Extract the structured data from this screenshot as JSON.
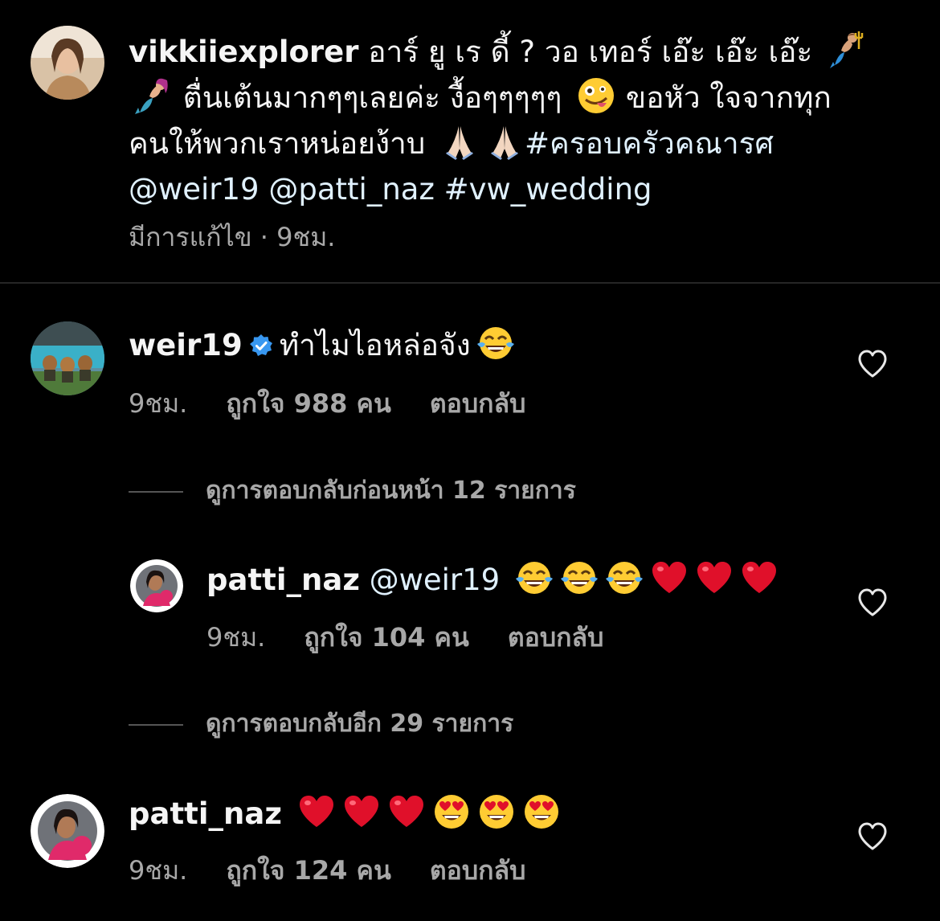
{
  "caption": {
    "username": "vikkiiexplorer",
    "text_line1": " อาร์ ยู เร ดี้ ? วอ เทอร์ เอ๊ะ เอ๊ะ เอ๊ะ ",
    "text_line2": " ตื่นเต้นมากๆๆเลยค่ะ งื้อๆๆๆๆๆ ",
    "text_line2b": "  ขอหัว ใจจากทุก",
    "text_line3": "คนให้พวกเราหน่อยง้าบ ",
    "hashtag1": "#ครอบครัวคณารศ",
    "mention1": "@weir19",
    "mention2": "@patti_naz",
    "hashtag2": "#vw_wedding",
    "meta_edited": "มีการแก้ไข · 9ชม."
  },
  "comments": [
    {
      "username": "weir19",
      "verified": true,
      "text": "ทำไมไอหล่อจัง",
      "time": "9ชม.",
      "likes": "ถูกใจ 988 คน",
      "reply": "ตอบกลับ"
    },
    {
      "username": "patti_naz",
      "mention": "@weir19",
      "time": "9ชม.",
      "likes": "ถูกใจ 104 คน",
      "reply": "ตอบกลับ"
    },
    {
      "username": "patti_naz",
      "time": "9ชม.",
      "likes": "ถูกใจ 124 คน",
      "reply": "ตอบกลับ"
    }
  ],
  "view_previous_replies": "ดูการตอบกลับก่อนหน้า 12 รายการ",
  "view_more_replies": "ดูการตอบกลับอีก 29 รายการ",
  "icons": {
    "like": "heart-outline-icon",
    "verified": "verified-badge-icon",
    "emoji_laugh": "face-with-tears-of-joy",
    "emoji_heart": "red-heart",
    "emoji_heart_eyes": "smiling-face-with-heart-eyes",
    "emoji_merman": "merman",
    "emoji_mermaid": "mermaid",
    "emoji_zany": "zany-face",
    "emoji_pray": "folded-hands"
  },
  "colors": {
    "background": "#000000",
    "text": "#f5f5f5",
    "secondary": "#a8a8a8",
    "link": "#e0f1ff",
    "verified": "#3897f0",
    "heart": "#e0102a"
  }
}
